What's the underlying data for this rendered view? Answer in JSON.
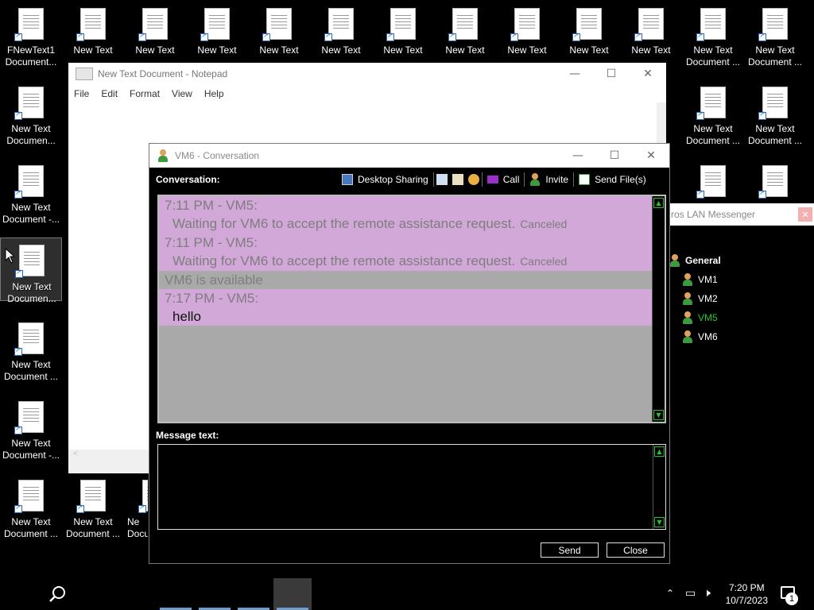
{
  "desktop": {
    "icons": [
      {
        "label": "FNewText1 Document..."
      },
      {
        "label": "New Text"
      },
      {
        "label": "New Text"
      },
      {
        "label": "New Text"
      },
      {
        "label": "New Text"
      },
      {
        "label": "New Text"
      },
      {
        "label": "New Text"
      },
      {
        "label": "New Text"
      },
      {
        "label": "New Text"
      },
      {
        "label": "New Text"
      },
      {
        "label": "New Text"
      },
      {
        "label": "New Text Document ..."
      },
      {
        "label": "New Text Document ..."
      },
      {
        "label": "New Text Documen..."
      },
      {
        "label": "New Text Document ..."
      },
      {
        "label": "New Text Document ..."
      },
      {
        "label": "New Text Document -..."
      },
      {
        "label": "New Text Documen..."
      },
      {
        "label": "New Text Document ..."
      },
      {
        "label": "New Text Document -..."
      },
      {
        "label": "New Text Document ..."
      },
      {
        "label": "New Text Document ..."
      },
      {
        "label": "Ne Docu"
      }
    ]
  },
  "notepad": {
    "title": "New Text Document - Notepad",
    "menu": [
      "File",
      "Edit",
      "Format",
      "View",
      "Help"
    ]
  },
  "lan_messenger": {
    "title": "ros LAN Messenger",
    "close": "✕",
    "group": "General",
    "users": [
      "VM1",
      "VM2",
      "VM5",
      "VM6"
    ],
    "selected_user": "VM5"
  },
  "conversation": {
    "title": "VM6 - Conversation",
    "conversation_label": "Conversation:",
    "toolbar": {
      "desktop_sharing": "Desktop Sharing",
      "call": "Call",
      "invite": "Invite",
      "send_files": "Send File(s)"
    },
    "history": [
      {
        "type": "header",
        "text": "7:11 PM - VM5:",
        "style": "pink"
      },
      {
        "type": "message",
        "text": "Waiting for VM6 to accept the remote assistance request.",
        "status": "Canceled",
        "style": "pink"
      },
      {
        "type": "header",
        "text": "7:11 PM - VM5:",
        "style": "pink"
      },
      {
        "type": "message",
        "text": "Waiting for VM6 to accept the remote assistance request.",
        "status": "Canceled",
        "style": "pink"
      },
      {
        "type": "status",
        "text": "VM6 is available",
        "style": "gray"
      },
      {
        "type": "header",
        "text": "7:17 PM - VM5:",
        "style": "pink"
      },
      {
        "type": "message",
        "text": "hello",
        "status": "",
        "style": "pink-dark"
      }
    ],
    "message_label": "Message text:",
    "message_value": "",
    "send": "Send",
    "close": "Close"
  },
  "taskbar": {
    "time": "7:20 PM",
    "date": "10/7/2023",
    "notifications": "1"
  },
  "colors": {
    "accent_green": "#29c229",
    "history_bg": "#a9a9a9",
    "history_pink": "#d2a8d8"
  }
}
